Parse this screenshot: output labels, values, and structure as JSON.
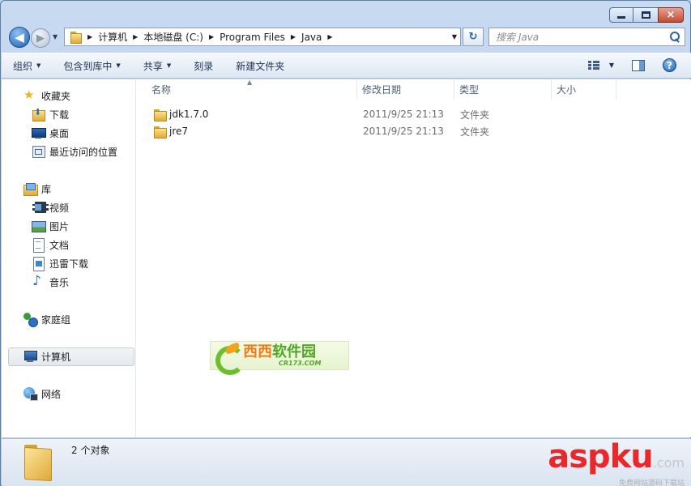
{
  "window": {
    "caption_buttons": {
      "minimize": "minimize-icon",
      "maximize": "maximize-icon",
      "close": "×"
    }
  },
  "navigation": {
    "back_glyph": "◀",
    "forward_glyph": "▶",
    "breadcrumb": [
      "计算机",
      "本地磁盘 (C:)",
      "Program Files",
      "Java"
    ],
    "refresh_glyph": "↻"
  },
  "search": {
    "placeholder": "搜索 Java"
  },
  "toolbar": {
    "organize": "组织",
    "include_in_library": "包含到库中",
    "share": "共享",
    "burn": "刻录",
    "new_folder": "新建文件夹",
    "help_glyph": "?"
  },
  "sidebar": {
    "favorites": {
      "label": "收藏夹",
      "items": [
        "下载",
        "桌面",
        "最近访问的位置"
      ]
    },
    "libraries": {
      "label": "库",
      "items": [
        "视频",
        "图片",
        "文档",
        "迅雷下载",
        "音乐"
      ]
    },
    "homegroup": "家庭组",
    "computer": "计算机",
    "network": "网络"
  },
  "columns": {
    "name": "名称",
    "date": "修改日期",
    "type": "类型",
    "size": "大小"
  },
  "files": [
    {
      "name": "jdk1.7.0",
      "date": "2011/9/25 21:13",
      "type": "文件夹"
    },
    {
      "name": "jre7",
      "date": "2011/9/25 21:13",
      "type": "文件夹"
    }
  ],
  "watermark": {
    "text_a": "西西",
    "text_b": "软件园",
    "sub": "CR173.COM"
  },
  "status": {
    "object_count": "2 个对象"
  },
  "corner_watermark": {
    "main": "aspku",
    "suffix": ".com",
    "sub": "免费网站源码下载站"
  },
  "colors": {
    "accent": "#2d63a8",
    "watermark_red": "#e8282a",
    "watermark_green": "#4fa823",
    "watermark_orange": "#f27a12"
  }
}
